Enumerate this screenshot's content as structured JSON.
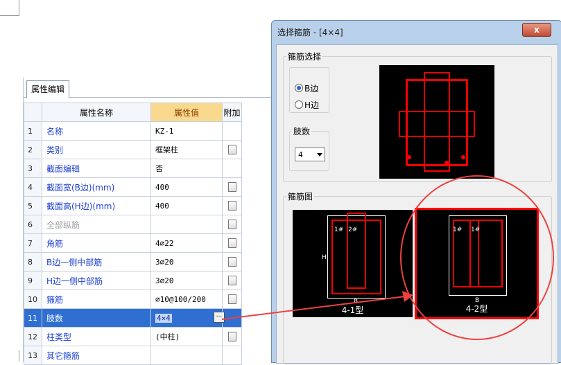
{
  "property_panel": {
    "tab_label": "属性编辑",
    "columns": {
      "name": "属性名称",
      "value": "属性值",
      "extra": "附加"
    },
    "rows": [
      {
        "num": "1",
        "name": "名称",
        "value": "KZ-1",
        "checkbox": false,
        "gray": false
      },
      {
        "num": "2",
        "name": "类别",
        "value": "框架柱",
        "checkbox": true,
        "gray": false
      },
      {
        "num": "3",
        "name": "截面编辑",
        "value": "否",
        "checkbox": false,
        "gray": false
      },
      {
        "num": "4",
        "name": "截面宽(B边)(mm)",
        "value": "400",
        "checkbox": true,
        "gray": false
      },
      {
        "num": "5",
        "name": "截面高(H边)(mm)",
        "value": "400",
        "checkbox": true,
        "gray": false
      },
      {
        "num": "6",
        "name": "全部纵筋",
        "value": "",
        "checkbox": true,
        "gray": true
      },
      {
        "num": "7",
        "name": "角筋",
        "value": "4⌀22",
        "checkbox": true,
        "gray": false
      },
      {
        "num": "8",
        "name": "B边一侧中部筋",
        "value": "3⌀20",
        "checkbox": true,
        "gray": false
      },
      {
        "num": "9",
        "name": "H边一侧中部筋",
        "value": "3⌀20",
        "checkbox": true,
        "gray": false
      },
      {
        "num": "10",
        "name": "箍筋",
        "value": "⌀10@100/200",
        "checkbox": true,
        "gray": false
      },
      {
        "num": "11",
        "name": "肢数",
        "value": "4×4",
        "checkbox": false,
        "gray": false
      },
      {
        "num": "12",
        "name": "柱类型",
        "value": "(中柱)",
        "checkbox": true,
        "gray": false
      },
      {
        "num": "13",
        "name": "其它箍筋",
        "value": "",
        "checkbox": false,
        "gray": false
      }
    ],
    "more_button": "..."
  },
  "dialog": {
    "title": "选择箍筋 - [4×4]",
    "close_label": "x",
    "stirrup_select_label": "箍筋选择",
    "radio_b": "B边",
    "radio_h": "H边",
    "limbs_label": "肢数",
    "limbs_value": "4",
    "stirrup_diagram_label": "箍筋图",
    "types": [
      {
        "label": "4-1型",
        "dim_h": "H",
        "dim_b": "B",
        "tag1": "1#",
        "tag2": "2#"
      },
      {
        "label": "4-2型",
        "dim_b": "B",
        "tag1": "1#",
        "tag2": "1#"
      }
    ]
  },
  "colors": {
    "accent_red": "#ff0000",
    "selection_blue": "#2f6fd2",
    "header_orange": "#f9d98d"
  }
}
